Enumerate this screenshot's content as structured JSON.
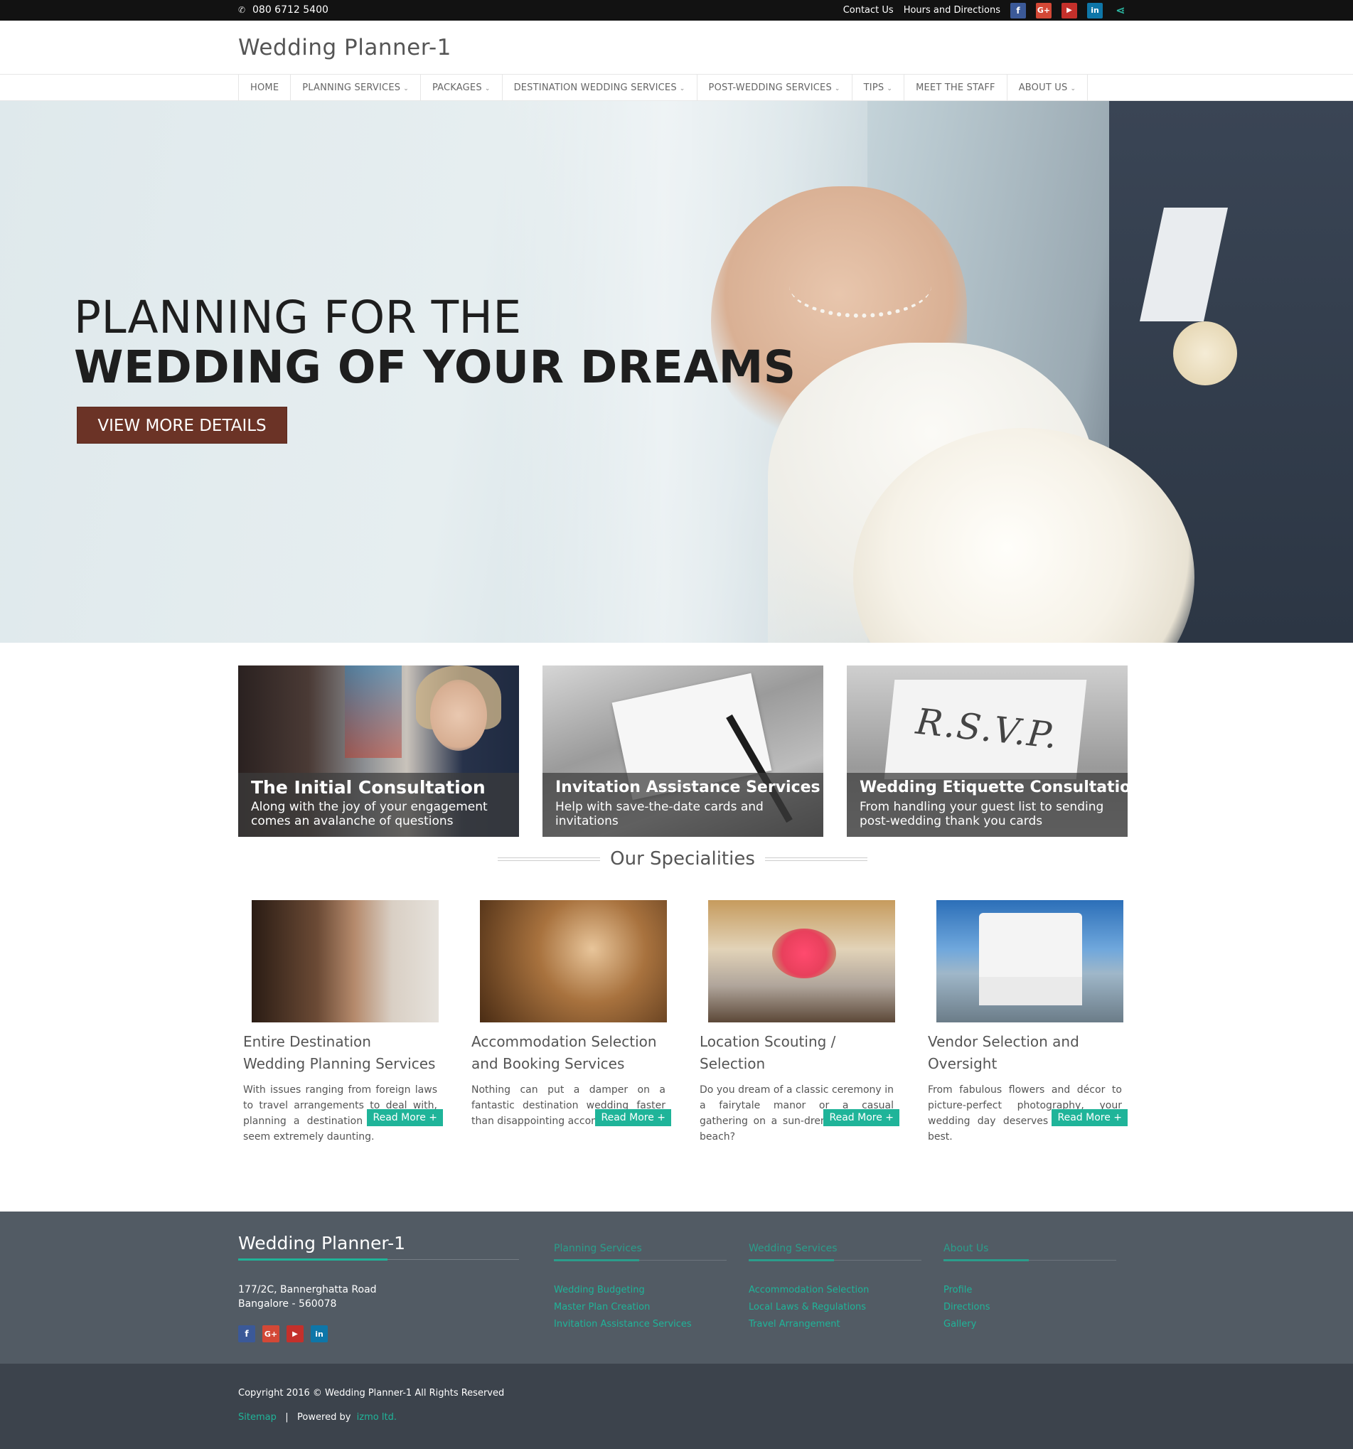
{
  "topbar": {
    "phone": "080 6712 5400",
    "contact": "Contact Us",
    "hours": "Hours and Directions",
    "social": [
      "facebook-icon",
      "google-plus-icon",
      "youtube-icon",
      "linkedin-icon",
      "share-icon"
    ]
  },
  "header": {
    "logo": "Wedding Planner-1"
  },
  "nav": {
    "items": [
      {
        "label": "HOME"
      },
      {
        "label": "PLANNING SERVICES"
      },
      {
        "label": "PACKAGES"
      },
      {
        "label": "DESTINATION WEDDING SERVICES"
      },
      {
        "label": "POST-WEDDING SERVICES"
      },
      {
        "label": "TIPS"
      },
      {
        "label": "MEET THE STAFF"
      },
      {
        "label": "ABOUT US"
      }
    ]
  },
  "hero": {
    "line1": "PLANNING FOR THE",
    "line2": "WEDDING OF YOUR DREAMS",
    "cta": "VIEW MORE DETAILS"
  },
  "cards": [
    {
      "title": "The Initial Consultation",
      "text": "Along with the joy of your engagement comes an avalanche of questions"
    },
    {
      "title": "Invitation Assistance Services",
      "text": "Help with save-the-date cards and invitations"
    },
    {
      "title": "Wedding Etiquette Consultations",
      "text": "From handling your guest list to sending post-wedding thank you cards"
    }
  ],
  "rsvp_art": "R.S.V.P.",
  "specialities": {
    "heading": "Our Specialities",
    "read_more": "Read More +",
    "items": [
      {
        "title": "Entire Destination Wedding Planning Services",
        "text": "With issues ranging from foreign laws to travel arrangements to deal with, planning a destination wedding can seem extremely daunting."
      },
      {
        "title": "Accommodation Selection and Booking Services",
        "text": "Nothing can put a damper on a fantastic destination wedding faster than disappointing accommodations"
      },
      {
        "title": "Location Scouting / Selection",
        "text": "Do you dream of a classic ceremony in a fairytale manor or a casual gathering on a sun-drenched tropical beach?"
      },
      {
        "title": "Vendor Selection and Oversight",
        "text": "From fabulous flowers and décor to picture-perfect photography, your wedding day deserves the absolute best."
      }
    ]
  },
  "footer": {
    "brand": "Wedding Planner-1",
    "address_line1": "177/2C, Bannerghatta Road",
    "address_line2": "Bangalore - 560078",
    "columns": [
      {
        "heading": "Planning Services",
        "links": [
          "Wedding Budgeting",
          "Master Plan Creation",
          "Invitation Assistance Services"
        ]
      },
      {
        "heading": "Wedding Services",
        "links": [
          "Accommodation Selection",
          "Local Laws & Regulations",
          "Travel Arrangement"
        ]
      },
      {
        "heading": "About Us",
        "links": [
          "Profile",
          "Directions",
          "Gallery"
        ]
      }
    ],
    "copyright": "Copyright 2016 © Wedding Planner-1 All Rights Reserved",
    "sitemap": "Sitemap",
    "separator": "|",
    "powered_by": "Powered by",
    "powered_link": "izmo ltd."
  },
  "colors": {
    "accent": "#1fb499",
    "cta_brown": "#6b3326",
    "footer_bg": "#525b64",
    "copyright_bg": "#3c434c"
  }
}
